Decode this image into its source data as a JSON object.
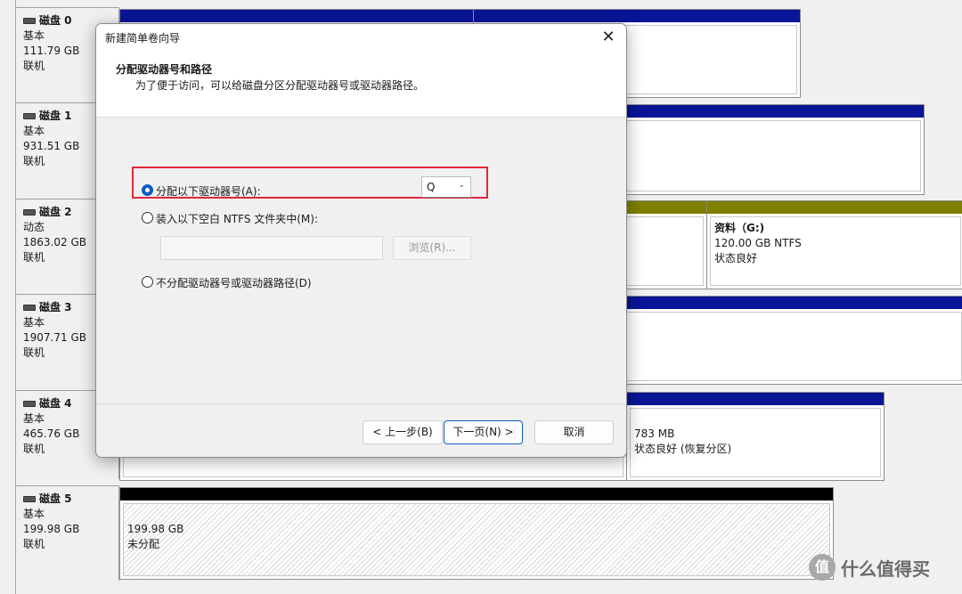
{
  "disks": [
    {
      "name": "磁盘 0",
      "type": "基本",
      "size": "111.79 GB",
      "status": "联机"
    },
    {
      "name": "磁盘 1",
      "type": "基本",
      "size": "931.51 GB",
      "status": "联机"
    },
    {
      "name": "磁盘 2",
      "type": "动态",
      "size": "1863.02 GB",
      "status": "联机"
    },
    {
      "name": "磁盘 3",
      "type": "基本",
      "size": "1907.71 GB",
      "status": "联机"
    },
    {
      "name": "磁盘 4",
      "type": "基本",
      "size": "465.76 GB",
      "status": "联机"
    },
    {
      "name": "磁盘 5",
      "type": "基本",
      "size": "199.98 GB",
      "status": "联机"
    }
  ],
  "partitions": {
    "disk2_data": {
      "title": "资料（G:)",
      "size": "120.00 GB NTFS",
      "status": "状态良好"
    },
    "disk4_recovery": {
      "size": "783 MB",
      "status": "状态良好 (恢复分区)"
    },
    "disk5_unalloc": {
      "size": "199.98 GB",
      "status": "未分配"
    }
  },
  "dialog": {
    "title": "新建简单卷向导",
    "heading": "分配驱动器号和路径",
    "subheading": "为了便于访问，可以给磁盘分区分配驱动器号或驱动器路径。",
    "options": {
      "assign_letter": "分配以下驱动器号(A):",
      "mount_folder": "装入以下空白 NTFS 文件夹中(M):",
      "no_assign": "不分配驱动器号或驱动器路径(D)"
    },
    "selected_letter": "Q",
    "browse_label": "浏览(R)...",
    "back_label": "< 上一步(B)",
    "next_label": "下一页(N) >",
    "cancel_label": "取消",
    "close_glyph": "✕"
  },
  "watermark": {
    "logo": "值",
    "text": "什么值得买"
  },
  "colors": {
    "primary_bar": "#0a1496",
    "olive_bar": "#7f7f00",
    "highlight": "#e0283a",
    "accent": "#0a5cc2"
  }
}
